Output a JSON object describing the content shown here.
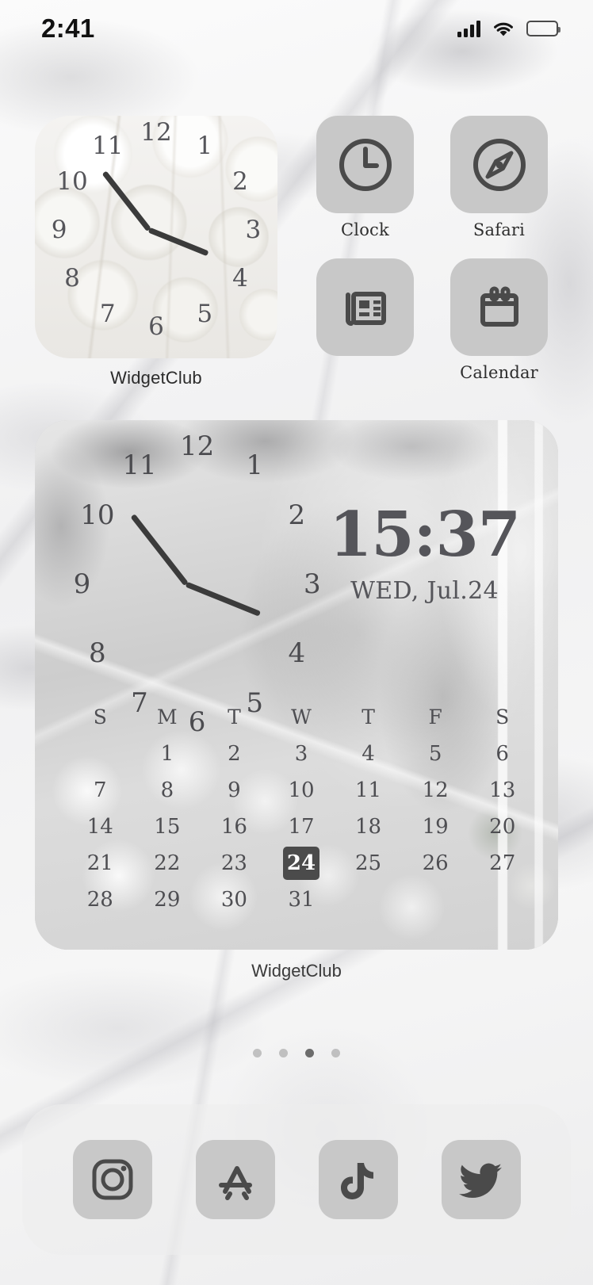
{
  "status_bar": {
    "time": "2:41",
    "icons": [
      "cellular-signal-icon",
      "wifi-icon",
      "battery-icon"
    ],
    "signal_bars": 4,
    "battery_full": true
  },
  "theme": {
    "wallpaper": "white-marble",
    "tile_color": "#c8c8c8",
    "icon_color": "#4a4a4a",
    "label_color": "#2e2e2e",
    "accent_today": "#4b4b4b"
  },
  "widgets": {
    "clock_small": {
      "label": "WidgetClub",
      "type": "analog-clock",
      "background": "white-balloons-photo",
      "numerals": [
        "12",
        "1",
        "2",
        "3",
        "4",
        "5",
        "6",
        "7",
        "8",
        "9",
        "10",
        "11"
      ],
      "hour_hand_deg": 232,
      "minute_hand_deg": 22
    },
    "clock_calendar_large": {
      "label": "WidgetClub",
      "type": "analog-clock-digital-calendar",
      "background": "grey-window-flowers-photo",
      "numerals": [
        "12",
        "1",
        "2",
        "3",
        "4",
        "5",
        "6",
        "7",
        "8",
        "9",
        "10",
        "11"
      ],
      "hour_hand_deg": 232,
      "minute_hand_deg": 22,
      "digital_time": "15:37",
      "digital_date": "WED, Jul.24",
      "calendar": {
        "weekday_headers": [
          "S",
          "M",
          "T",
          "W",
          "T",
          "F",
          "S"
        ],
        "today": 24,
        "weeks": [
          [
            "",
            "1",
            "2",
            "3",
            "4",
            "5",
            "6"
          ],
          [
            "7",
            "8",
            "9",
            "10",
            "11",
            "12",
            "13"
          ],
          [
            "14",
            "15",
            "16",
            "17",
            "18",
            "19",
            "20"
          ],
          [
            "21",
            "22",
            "23",
            "24",
            "25",
            "26",
            "27"
          ],
          [
            "28",
            "29",
            "30",
            "31",
            "",
            "",
            ""
          ]
        ]
      }
    }
  },
  "apps": [
    {
      "label": "Clock",
      "icon": "clock-icon"
    },
    {
      "label": "Safari",
      "icon": "compass-icon"
    },
    {
      "label": "",
      "icon": "newspaper-icon"
    },
    {
      "label": "Calendar",
      "icon": "calendar-icon"
    }
  ],
  "page_dots": {
    "count": 4,
    "active_index": 2
  },
  "dock": [
    {
      "name": "Instagram",
      "icon": "instagram-icon"
    },
    {
      "name": "App Store",
      "icon": "app-store-icon"
    },
    {
      "name": "TikTok",
      "icon": "tiktok-icon"
    },
    {
      "name": "Twitter",
      "icon": "twitter-bird-icon"
    }
  ]
}
